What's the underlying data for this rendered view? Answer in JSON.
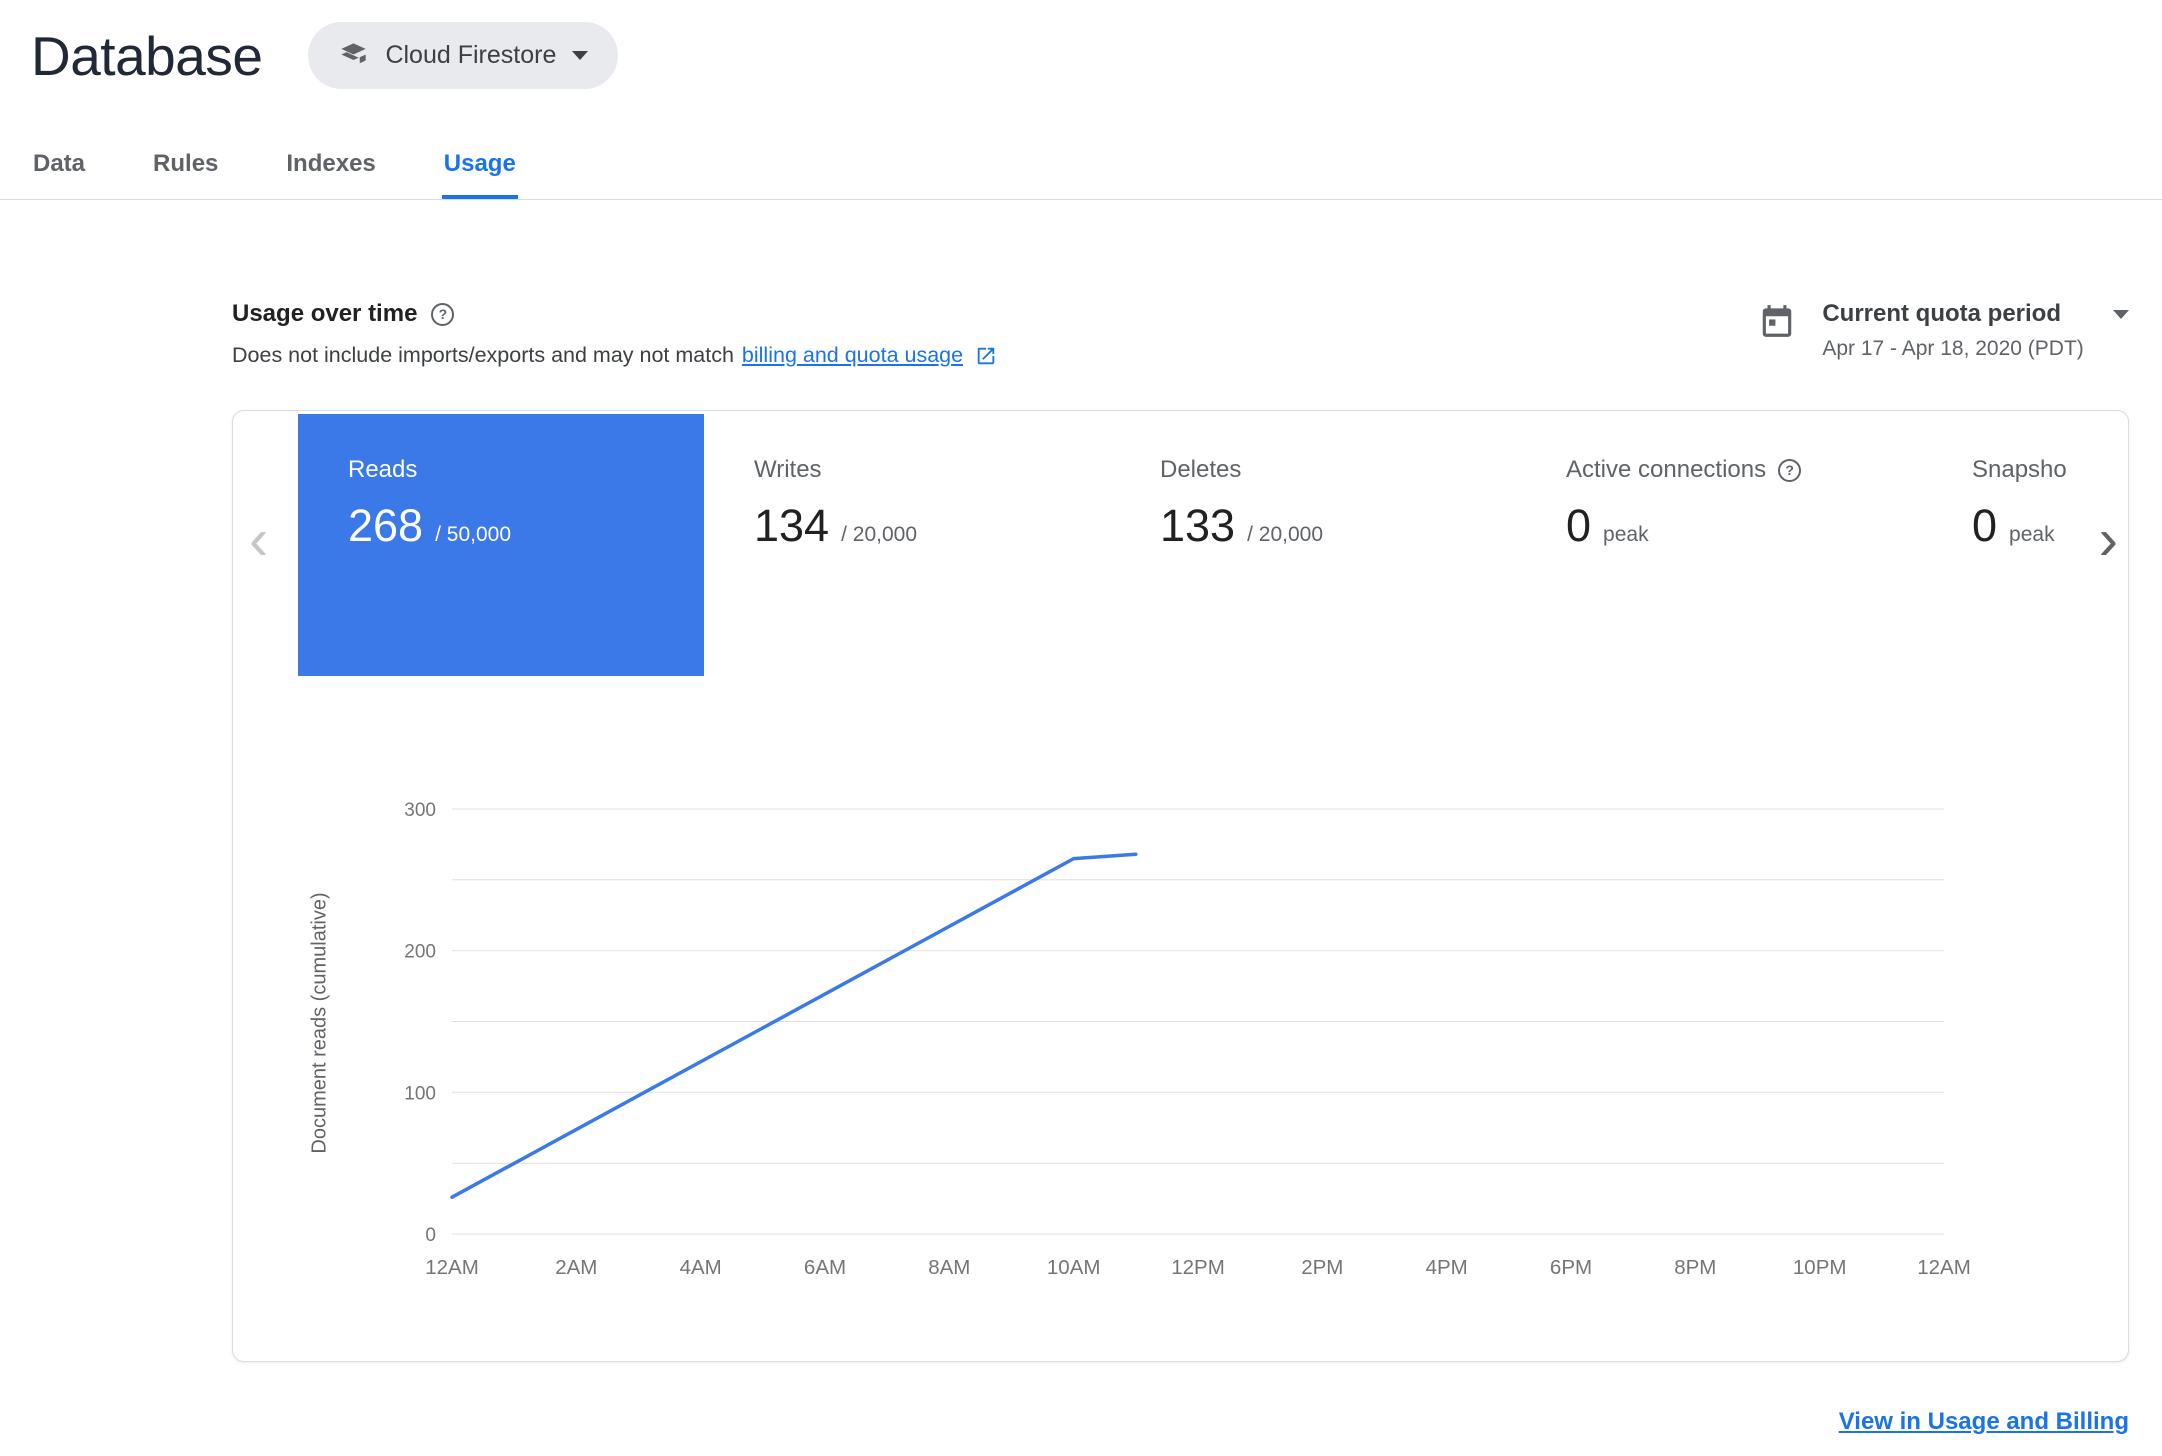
{
  "colors": {
    "accent": "#1a73e8",
    "selected_tile": "#3b78e8",
    "grid": "#e0e0e0",
    "tick_label": "#757575"
  },
  "header": {
    "title": "Database",
    "product_selector": {
      "label": "Cloud Firestore"
    }
  },
  "tabs": [
    {
      "label": "Data",
      "active": false
    },
    {
      "label": "Rules",
      "active": false
    },
    {
      "label": "Indexes",
      "active": false
    },
    {
      "label": "Usage",
      "active": true
    }
  ],
  "usage_header": {
    "title": "Usage over time",
    "subtitle_prefix": "Does not include imports/exports and may not match",
    "subtitle_link": "billing and quota usage",
    "quota_period": {
      "label": "Current quota period",
      "range": "Apr 17 - Apr 18, 2020 (PDT)"
    }
  },
  "metrics": [
    {
      "label": "Reads",
      "value": "268",
      "suffix": "/ 50,000",
      "selected": true,
      "help": false
    },
    {
      "label": "Writes",
      "value": "134",
      "suffix": "/ 20,000",
      "selected": false,
      "help": false
    },
    {
      "label": "Deletes",
      "value": "133",
      "suffix": "/ 20,000",
      "selected": false,
      "help": false
    },
    {
      "label": "Active connections",
      "value": "0",
      "suffix": "peak",
      "selected": false,
      "help": true
    },
    {
      "label": "Snapsho",
      "value": "0",
      "suffix": "peak",
      "selected": false,
      "help": false
    }
  ],
  "footer": {
    "link_label": "View in Usage and Billing"
  },
  "chart_data": {
    "type": "line",
    "title": "",
    "ylabel": "Document reads (cumulative)",
    "xlabel": "",
    "ylim": [
      0,
      300
    ],
    "y_tick_labels": [
      0,
      100,
      200,
      300
    ],
    "gridline_step": 50,
    "grid": true,
    "legend": "none",
    "x_range_hours": [
      0,
      24
    ],
    "x_tick_labels": [
      "12AM",
      "2AM",
      "4AM",
      "6AM",
      "8AM",
      "10AM",
      "12PM",
      "2PM",
      "4PM",
      "6PM",
      "8PM",
      "10PM",
      "12AM"
    ],
    "series": [
      {
        "name": "Document reads (cumulative)",
        "color": "#3b78e8",
        "points": [
          {
            "hour": 0,
            "value": 26
          },
          {
            "hour": 10,
            "value": 265
          },
          {
            "hour": 11,
            "value": 268
          }
        ]
      }
    ]
  }
}
